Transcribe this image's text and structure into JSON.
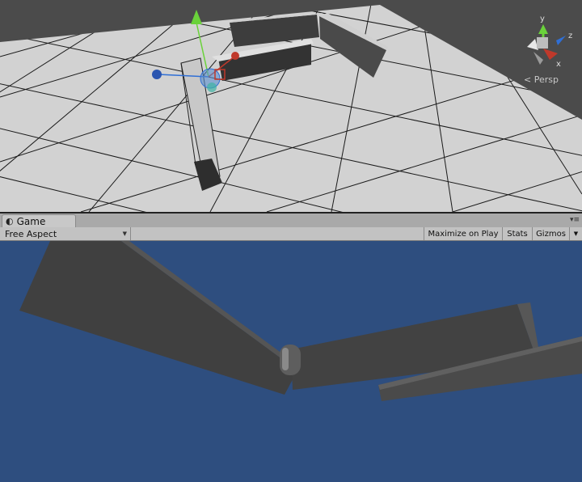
{
  "scene": {
    "projection_label": "Persp",
    "axis_labels": {
      "y": "y",
      "z": "z",
      "x": "x"
    },
    "colors": {
      "floor": "#d2d2d2",
      "wall_dark": "#4a4a4a",
      "x_axis": "#c0392b",
      "y_axis": "#6ad23a",
      "z_axis": "#2f6fd6"
    }
  },
  "game_panel": {
    "tab_label": "Game",
    "tab_icon": "pacman-icon",
    "aspect_label": "Free Aspect",
    "maximize_label": "Maximize on Play",
    "stats_label": "Stats",
    "gizmos_label": "Gizmos",
    "colors": {
      "sky": "#2e4e7f",
      "wall": "#3f3f3f"
    }
  }
}
